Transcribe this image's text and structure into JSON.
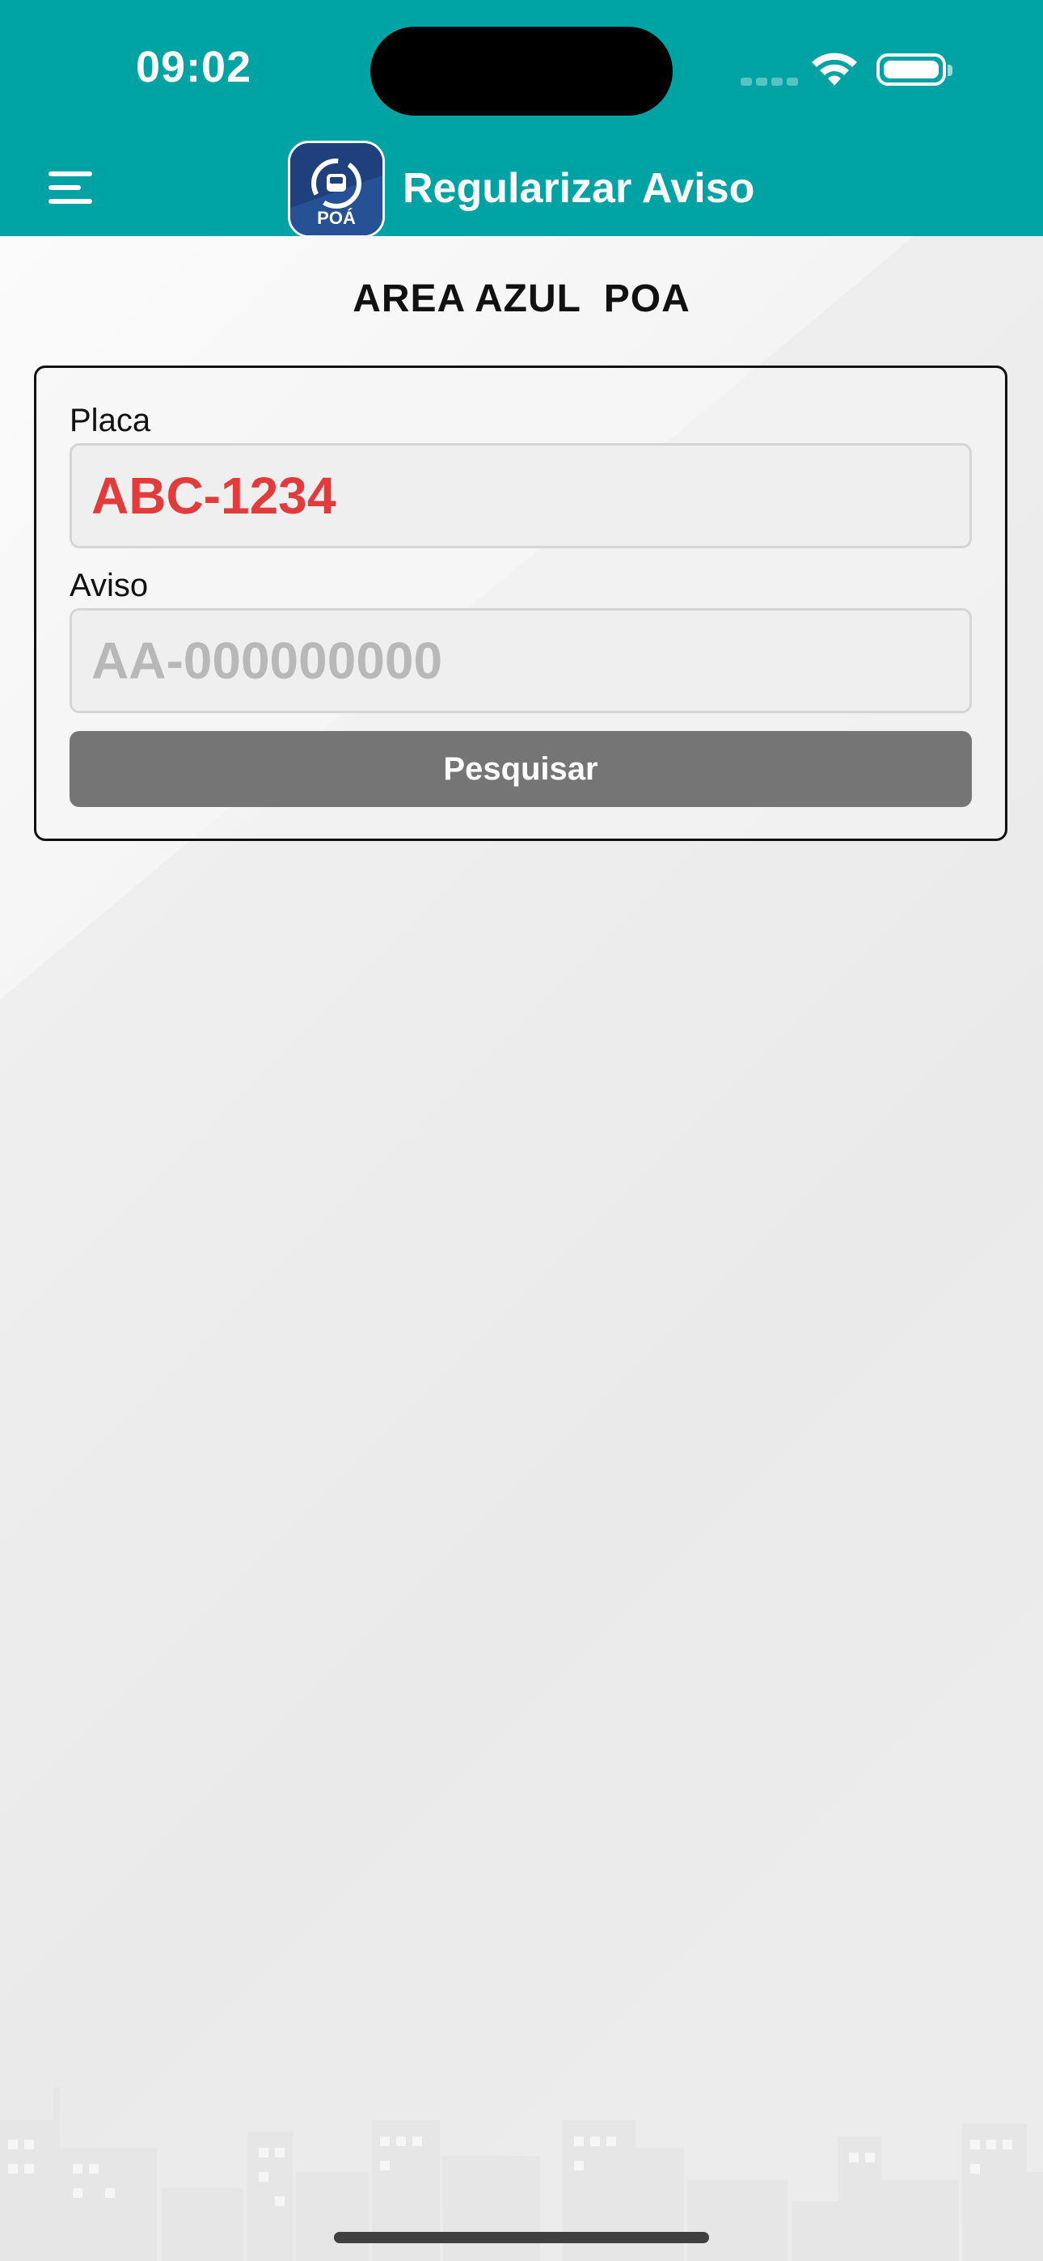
{
  "status_bar": {
    "time": "09:02"
  },
  "header": {
    "title": "Regularizar Aviso",
    "logo_text": "POÁ",
    "menu_icon": "hamburger-menu-icon",
    "background_color": "#00a3a3"
  },
  "main": {
    "section_title": "AREA AZUL  POA",
    "form": {
      "plate_label": "Placa",
      "plate_value": "ABC-1234",
      "notice_label": "Aviso",
      "notice_placeholder": "AA-000000000",
      "search_label": "Pesquisar"
    }
  },
  "colors": {
    "plate_text": "#e23b3b",
    "button": "#757575"
  }
}
